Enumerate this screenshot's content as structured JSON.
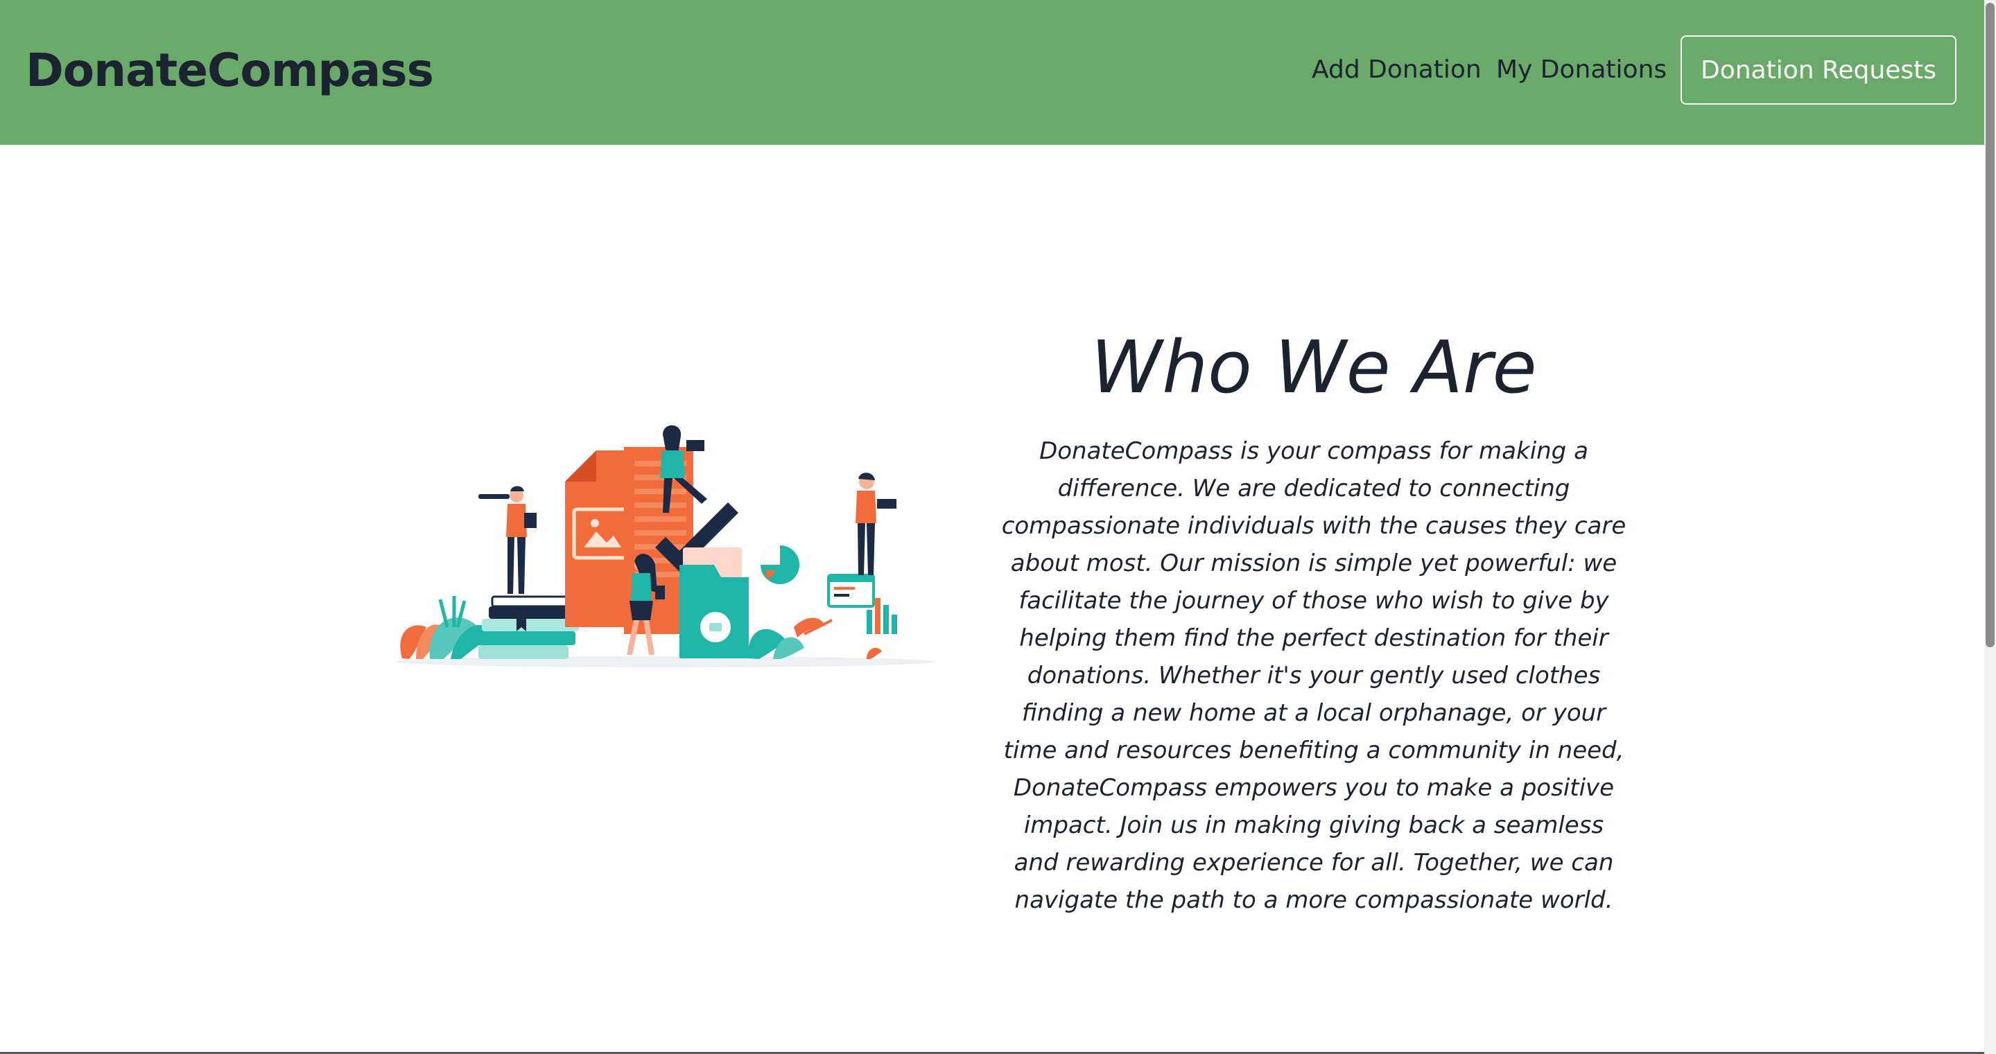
{
  "navbar": {
    "brand": "DonateCompass",
    "links": {
      "add_donation": "Add Donation",
      "my_donations": "My Donations"
    },
    "cta_button": "Donation Requests"
  },
  "main": {
    "heading": "Who We Are",
    "body": "DonateCompass is your compass for making a difference. We are dedicated to connecting compassionate individuals with the causes they care about most. Our mission is simple yet powerful: we facilitate the journey of those who wish to give by helping them find the perfect destination for their donations. Whether it's your gently used clothes finding a new home at a local orphanage, or your time and resources benefiting a community in need, DonateCompass empowers you to make a positive impact. Join us in making giving back a seamless and rewarding experience for all. Together, we can navigate the path to a more compassionate world.",
    "illustration_icon": "team-documents-illustration"
  },
  "colors": {
    "navbar_bg": "#6aaa69",
    "text_dark": "#1b2331",
    "accent_orange": "#f26b3a",
    "accent_teal": "#1fb5a8",
    "accent_navy": "#1c2a44"
  }
}
